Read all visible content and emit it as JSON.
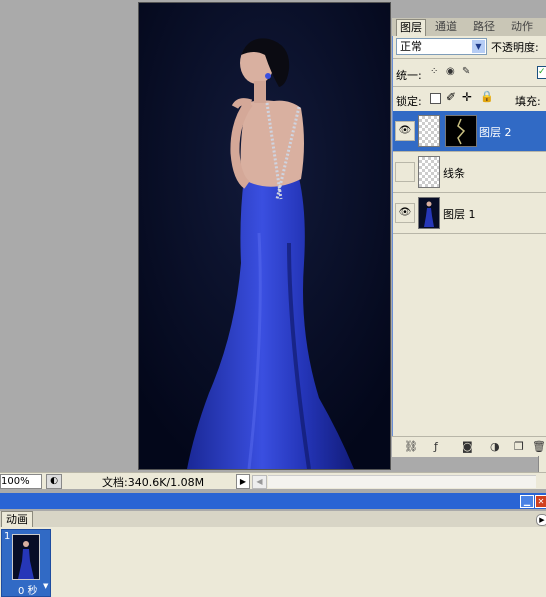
{
  "layers_panel": {
    "tabs": [
      {
        "label": "图层",
        "active": true
      },
      {
        "label": "通道",
        "active": false
      },
      {
        "label": "路径",
        "active": false
      },
      {
        "label": "动作",
        "active": false
      }
    ],
    "blend_mode": "正常",
    "opacity_label": "不透明度:",
    "unify_label": "统一:",
    "lock_label": "锁定:",
    "fill_label": "填充:",
    "layers": [
      {
        "name": "图层 2",
        "visible": true,
        "selected": true
      },
      {
        "name": "线条",
        "visible": false,
        "selected": false
      },
      {
        "name": "图层 1",
        "visible": true,
        "selected": false
      }
    ]
  },
  "status": {
    "zoom": "100%",
    "doc_label": "文档:340.6K/1.08M"
  },
  "animation_panel": {
    "tab_label": "动画",
    "frame_number": "1",
    "frame_delay": "0 秒"
  },
  "colors": {
    "selection": "#316ac5",
    "panel_bg": "#ece9d8",
    "titlebar": "#2a64d4",
    "canvas_bg": "#070d26",
    "dress": "#2637b8"
  }
}
